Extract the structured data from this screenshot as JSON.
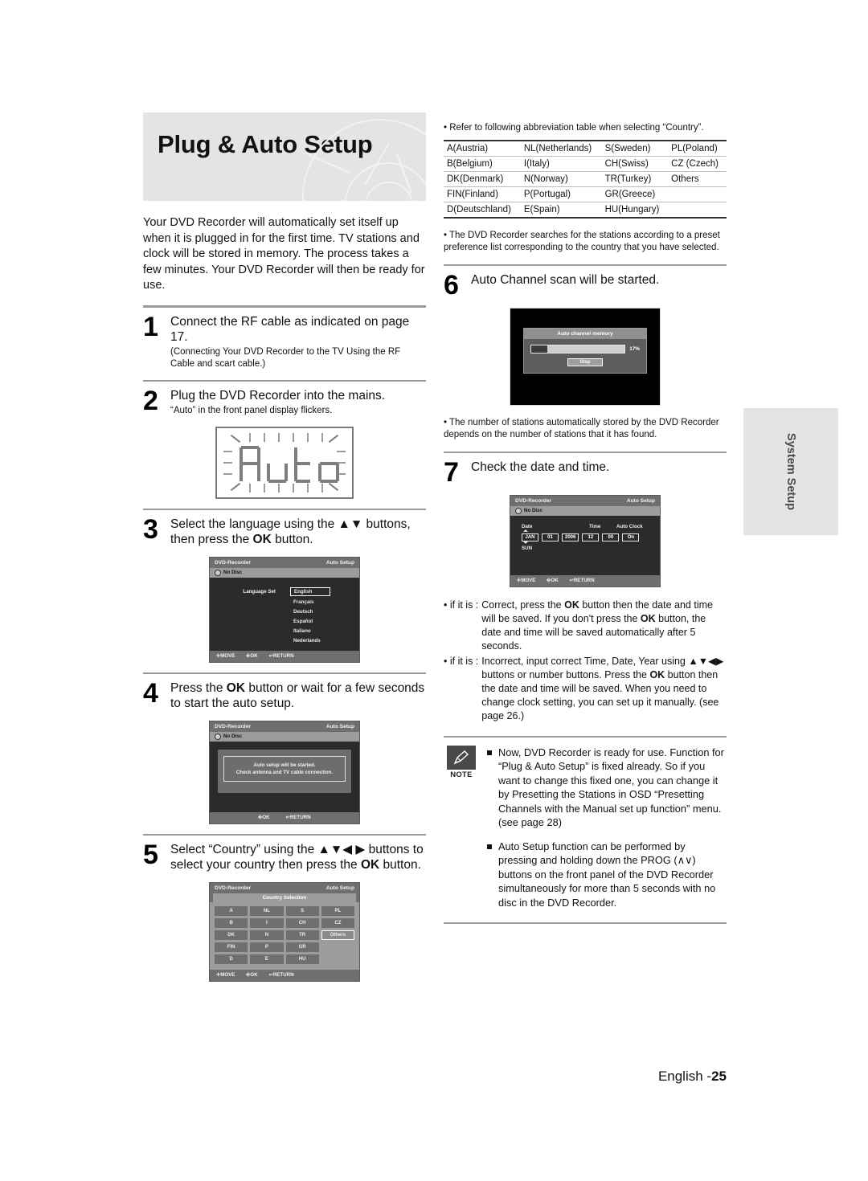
{
  "banner": {
    "title": "Plug & Auto Setup"
  },
  "intro": "Your DVD Recorder will automatically set itself up when it is plugged in for the first time. TV stations and clock will be stored in memory. The process takes a few minutes. Your DVD Recorder will then be ready for use.",
  "steps": [
    {
      "num": "1",
      "title": "Connect the RF cable as indicated on page 17.",
      "sub": "(Connecting Your DVD Recorder to the TV Using the RF Cable and scart cable.)"
    },
    {
      "num": "2",
      "title": "Plug the DVD Recorder into the mains.",
      "sub": "“Auto” in the front panel display flickers.",
      "led_text": "Auto"
    },
    {
      "num": "3",
      "title_pre": "Select the language using the ▲▼ buttons, then press the ",
      "title_ok": "OK",
      "title_post": " button."
    },
    {
      "num": "4",
      "title_pre": "Press the ",
      "title_ok": "OK",
      "title_post": " button or wait for a few seconds to start the auto setup."
    },
    {
      "num": "5",
      "title_pre": "Select “Country” using the ▲▼◀ ▶ buttons to select your country then press the ",
      "title_ok": "OK",
      "title_post": " button."
    },
    {
      "num": "6",
      "title": "Auto Channel scan will be started."
    },
    {
      "num": "7",
      "title": "Check the date and time."
    }
  ],
  "osd_language": {
    "header_left": "DVD-Recorder",
    "header_right": "Auto Setup",
    "disc_status": "No Disc",
    "label": "Language Set",
    "options": [
      "English",
      "Français",
      "Deutsch",
      "Español",
      "Italiano",
      "Nederlands"
    ],
    "selected": "English",
    "footer": [
      "MOVE",
      "OK",
      "RETURN"
    ]
  },
  "osd_autosetup": {
    "header_left": "DVD-Recorder",
    "header_right": "Auto Setup",
    "disc_status": "No Disc",
    "line1": "Auto setup will be started.",
    "line2": "Check antenna and TV cable connection.",
    "footer": [
      "OK",
      "RETURN"
    ]
  },
  "osd_country": {
    "header_left": "DVD-Recorder",
    "header_right": "Auto Setup",
    "subheader": "Country Selection",
    "buttons": [
      "A",
      "NL",
      "S",
      "PL",
      "B",
      "I",
      "CH",
      "CZ",
      "DK",
      "N",
      "TR",
      "Others",
      "FIN",
      "P",
      "GR",
      "",
      "D",
      "E",
      "HU",
      ""
    ],
    "selected": "Others",
    "footer": [
      "MOVE",
      "OK",
      "RETURN"
    ]
  },
  "osd_channel_memory": {
    "title": "Auto channel memory",
    "percent_label": "17%",
    "percent_value": 17,
    "stop_label": "Stop"
  },
  "osd_datetime": {
    "header_left": "DVD-Recorder",
    "header_right": "Auto Setup",
    "disc_status": "No Disc",
    "labels": {
      "date": "Date",
      "time": "Time",
      "auto_clock": "Auto Clock"
    },
    "fields": {
      "month": "JAN",
      "day": "01",
      "year": "2006",
      "hour": "12",
      "minute": "00",
      "auto_clock": "On"
    },
    "weekday": "SUN",
    "footer": [
      "MOVE",
      "OK",
      "RETURN"
    ]
  },
  "abbr_note": "• Refer to following abbreviation table when selecting “Country”.",
  "abbr_table": [
    [
      "A(Austria)",
      "NL(Netherlands)",
      "S(Sweden)",
      "PL(Poland)"
    ],
    [
      "B(Belgium)",
      "I(Italy)",
      "CH(Swiss)",
      "CZ (Czech)"
    ],
    [
      "DK(Denmark)",
      "N(Norway)",
      "TR(Turkey)",
      "Others"
    ],
    [
      "FIN(Finland)",
      "P(Portugal)",
      "GR(Greece)",
      ""
    ],
    [
      "D(Deutschland)",
      "E(Spain)",
      "HU(Hungary)",
      ""
    ]
  ],
  "bullet_preset": "• The DVD Recorder searches for the stations according to a preset preference list corresponding to the country that you have selected.",
  "bullet_stations": "• The number of stations automatically stored by the DVD Recorder depends on the number of stations that it has found.",
  "if_correct": {
    "lead": "• if it is :",
    "text_a": "Correct, press the ",
    "ok1": "OK",
    "text_b": " button then the date and time will be saved. If you don't press the ",
    "ok2": "OK",
    "text_c": " button, the date and time will be saved automatically after 5 seconds."
  },
  "if_incorrect": {
    "lead": "• if it is :",
    "text_a": "Incorrect, input correct Time, Date, Year using ▲▼◀▶ buttons or number buttons. Press the ",
    "ok1": "OK",
    "text_b": " button then the date and time will be saved. When you need to change clock setting, you can set up it manually. (see page 26.)"
  },
  "note": {
    "label": "NOTE",
    "items": [
      "Now, DVD Recorder is ready for use. Function for “Plug & Auto Setup” is fixed already. So if you want to change this fixed one, you can change it by Presetting the Stations in OSD “Presetting Channels with the Manual set up function” menu. (see page 28)",
      "Auto Setup function can be performed by pressing and holding down the PROG (∧∨) buttons on the front panel of the DVD Recorder simultaneously for more than 5 seconds with no disc in the DVD Recorder."
    ]
  },
  "side_tab": {
    "label": "System Setup"
  },
  "footer": {
    "language": "English -",
    "page": "25"
  },
  "colors": {
    "banner_bg": "#e4e4e4",
    "rule": "#9a9a9a",
    "osd_bg": "#2b2b2b",
    "osd_bar": "#6f6f6f"
  }
}
